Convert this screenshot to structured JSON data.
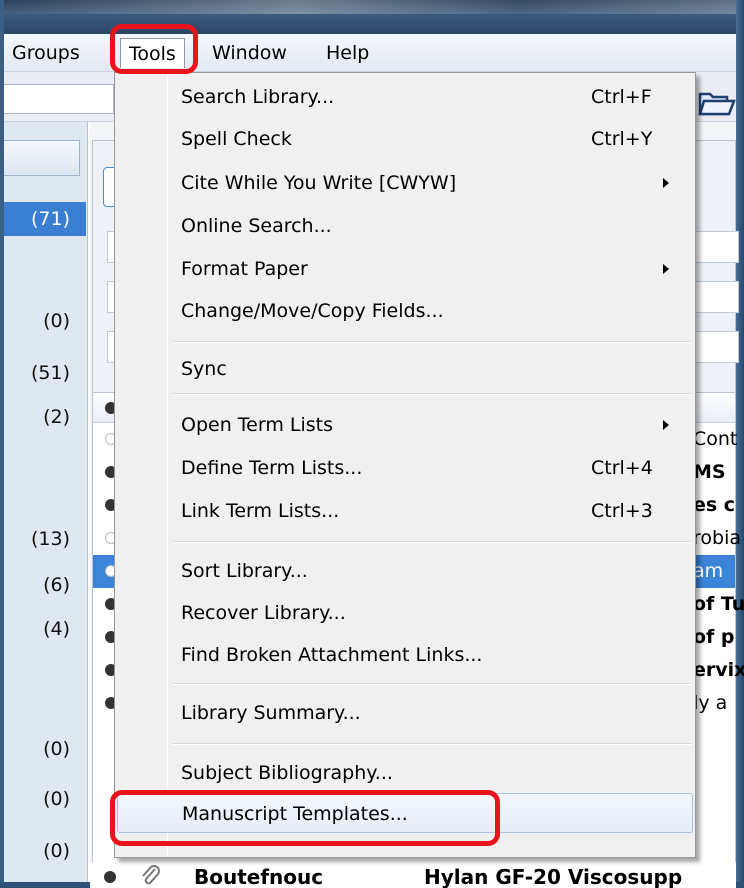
{
  "menubar": {
    "items": [
      "Groups",
      "Tools",
      "Window",
      "Help"
    ],
    "active": "Tools"
  },
  "tools_menu": {
    "groups": [
      [
        {
          "label": "Search Library...",
          "shortcut": "Ctrl+F",
          "submenu": false
        },
        {
          "label": "Spell Check",
          "shortcut": "Ctrl+Y",
          "submenu": false
        },
        {
          "label": "Cite While You Write [CWYW]",
          "shortcut": "",
          "submenu": true
        },
        {
          "label": "Online Search...",
          "shortcut": "",
          "submenu": false
        },
        {
          "label": "Format Paper",
          "shortcut": "",
          "submenu": true
        },
        {
          "label": "Change/Move/Copy Fields...",
          "shortcut": "",
          "submenu": false
        }
      ],
      [
        {
          "label": "Sync",
          "shortcut": "",
          "submenu": false
        }
      ],
      [
        {
          "label": "Open Term Lists",
          "shortcut": "",
          "submenu": true
        },
        {
          "label": "Define Term Lists...",
          "shortcut": "Ctrl+4",
          "submenu": false
        },
        {
          "label": "Link Term Lists...",
          "shortcut": "Ctrl+3",
          "submenu": false
        }
      ],
      [
        {
          "label": "Sort Library...",
          "shortcut": "",
          "submenu": false
        },
        {
          "label": "Recover Library...",
          "shortcut": "",
          "submenu": false
        },
        {
          "label": "Find Broken Attachment Links...",
          "shortcut": "",
          "submenu": false
        }
      ],
      [
        {
          "label": "Library Summary...",
          "shortcut": "",
          "submenu": false
        }
      ],
      [
        {
          "label": "Subject Bibliography...",
          "shortcut": "",
          "submenu": false
        },
        {
          "label": "Manuscript Templates...",
          "shortcut": "",
          "submenu": false,
          "hovered": true
        }
      ]
    ]
  },
  "groups_panel": {
    "counts": [
      "(71)",
      "(0)",
      "(51)",
      "(2)",
      "(13)",
      "(6)",
      "(4)",
      "(0)",
      "(0)",
      "(0)"
    ],
    "selected_index": 0
  },
  "reference_list": {
    "rows": [
      {
        "text": "Cont",
        "bold": false,
        "read": false
      },
      {
        "text": "MS",
        "bold": true,
        "read": true
      },
      {
        "text": "es c",
        "bold": true,
        "read": true
      },
      {
        "text": "robia",
        "bold": false,
        "read": false
      },
      {
        "text": "am",
        "bold": false,
        "read": false,
        "selected": true
      },
      {
        "text": "of Tu",
        "bold": true,
        "read": true
      },
      {
        "text": "of p",
        "bold": true,
        "read": true
      },
      {
        "text": "ervix",
        "bold": true,
        "read": true
      },
      {
        "text": "y index of body a",
        "bold": false,
        "read": true
      }
    ],
    "bottom_row": {
      "author": "Boutefnouc",
      "title": "Hylan GF-20 Viscosupp"
    }
  },
  "colors": {
    "highlight": "#e8141b",
    "selection": "#3b84d8",
    "menu_bg": "#f0f0f0"
  }
}
